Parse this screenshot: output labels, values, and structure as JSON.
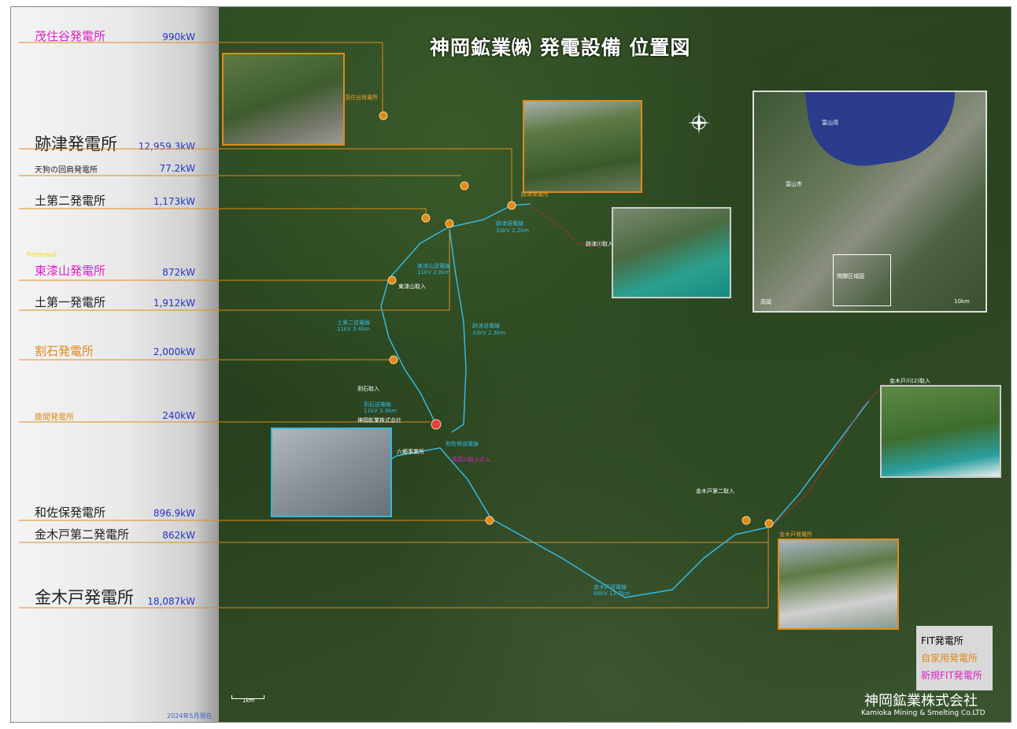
{
  "title": "神岡鉱業㈱ 発電設備 位置図",
  "colors": {
    "fit": "#333333",
    "private": "#e08a1a",
    "new_fit": "#e020c8",
    "power": "#2233cc",
    "line": "#e08a1a",
    "transmission": "#38b8e0"
  },
  "stations": [
    {
      "name": "茂住谷発電所",
      "power": "990kW",
      "category": "new_fit"
    },
    {
      "name": "跡津発電所",
      "power": "12,959.3kW",
      "category": "fit"
    },
    {
      "name": "天狗の回肩発電所",
      "power": "77.2kW",
      "category": "fit"
    },
    {
      "name": "土第二発電所",
      "power": "1,173kW",
      "category": "fit"
    },
    {
      "name": "東漆山発電所",
      "power": "872kW",
      "category": "new_fit",
      "badge": "Renewal"
    },
    {
      "name": "土第一発電所",
      "power": "1,912kW",
      "category": "fit"
    },
    {
      "name": "割石発電所",
      "power": "2,000kW",
      "category": "private"
    },
    {
      "name": "鹿間発電所",
      "power": "240kW",
      "category": "private"
    },
    {
      "name": "和佐保発電所",
      "power": "896.9kW",
      "category": "fit"
    },
    {
      "name": "金木戸第二発電所",
      "power": "862kW",
      "category": "fit"
    },
    {
      "name": "金木戸発電所",
      "power": "18,087kW",
      "category": "fit"
    }
  ],
  "map_labels": {
    "mozumi": "茂住谷発電所",
    "atotsu": "跡津発電所",
    "atotsu_line": "跡津送電線",
    "atotsu_line_spec": "33kV 2.2km",
    "atotsu_intake": "跡津川取入",
    "higashi_line": "東漆山送電線",
    "higashi_line_spec": "11kV 2.8km",
    "higashi_intake": "東漆山取入",
    "higashi_vert_line": "跡津送電線",
    "higashi_vert_spec": "33kV 2.3km",
    "tsuchi_line": "土第二送電線",
    "tsuchi_line_spec": "11kV 3.4km",
    "wariishi_intake": "割石取入",
    "wariishi_line": "割石送電線",
    "wariishi_spec": "11kV 3.3km",
    "kanakido_line": "金木戸送電線",
    "kanakido_spec": "66kV 13.7km",
    "kanakido_intake": "金木戸川(2)取入",
    "kanakido2_intake": "金木戸第二取入",
    "kanakido_station": "金木戸発電所",
    "wasabo_line": "和佐保送電線",
    "honkoku": "神岡鉱業株式会社",
    "mine": "六郷事業所",
    "kamioka": "高原川取入ダム",
    "inset_lake": "富山湾",
    "inset_city": "富山市",
    "inset_area": "飛騨区域図",
    "inset_scale": "10km",
    "inset_west": "高岡"
  },
  "legend": {
    "fit": "FIT発電所",
    "private": "自家用発電所",
    "new_fit": "新規FIT発電所"
  },
  "company": "神岡鉱業株式会社",
  "company_en": "Kamioka Mining & Smelting Co.LTD",
  "date": "2024年5月現在",
  "scale": "1km"
}
